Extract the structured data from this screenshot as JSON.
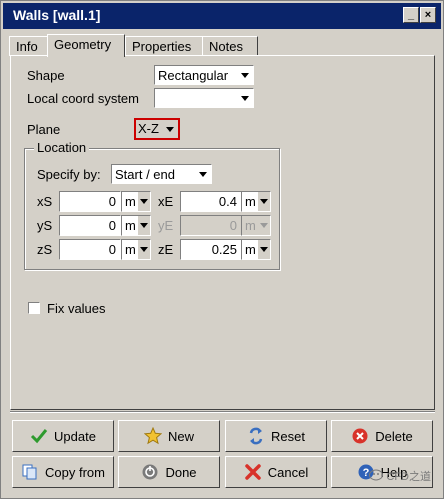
{
  "window": {
    "title": "Walls [wall.1]",
    "minimize": "_",
    "close": "×"
  },
  "tabs": [
    {
      "label": "Info"
    },
    {
      "label": "Geometry",
      "active": true
    },
    {
      "label": "Properties"
    },
    {
      "label": "Notes"
    }
  ],
  "shape": {
    "label": "Shape",
    "value": "Rectangular"
  },
  "local_coord": {
    "label": "Local coord system",
    "value": ""
  },
  "plane": {
    "label": "Plane",
    "value": "X-Z"
  },
  "location": {
    "title": "Location",
    "specify_label": "Specify by:",
    "specify_value": "Start / end",
    "xS": {
      "label": "xS",
      "value": "0",
      "unit": "m"
    },
    "yS": {
      "label": "yS",
      "value": "0",
      "unit": "m"
    },
    "zS": {
      "label": "zS",
      "value": "0",
      "unit": "m"
    },
    "xE": {
      "label": "xE",
      "value": "0.4",
      "unit": "m"
    },
    "yE": {
      "label": "yE",
      "value": "0",
      "unit": "m"
    },
    "zE": {
      "label": "zE",
      "value": "0.25",
      "unit": "m"
    }
  },
  "fix_values": {
    "label": "Fix values",
    "checked": false
  },
  "buttons": {
    "update": "Update",
    "new": "New",
    "reset": "Reset",
    "delete": "Delete",
    "copy_from": "Copy from",
    "done": "Done",
    "cancel": "Cancel",
    "help": "Help"
  },
  "watermark": "CFD之道",
  "colors": {
    "titlebar": "#0a246a",
    "face": "#d4d0c8",
    "plane_highlight": "#cc0000"
  }
}
